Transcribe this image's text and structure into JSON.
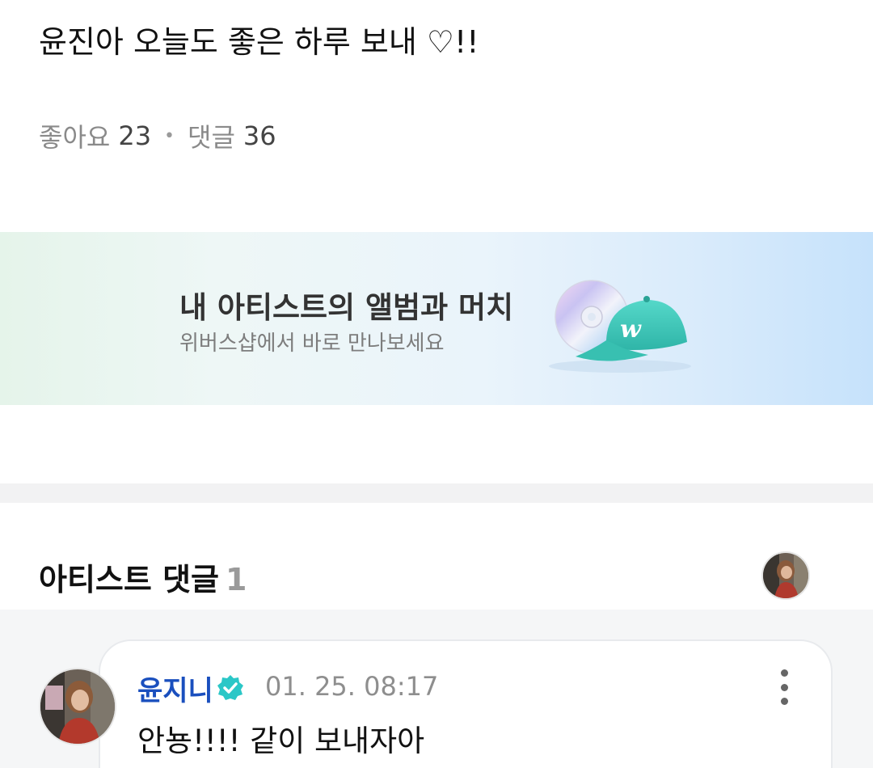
{
  "post": {
    "text": "윤진아 오늘도 좋은 하루 보내 ♡!!",
    "likes_label": "좋아요",
    "likes_count": "23",
    "comments_label": "댓글",
    "comments_count": "36"
  },
  "banner": {
    "title": "내 아티스트의 앨범과 머치",
    "subtitle": "위버스샵에서 바로 만나보세요",
    "icon": "album-and-cap-icon"
  },
  "artist_comments": {
    "title": "아티스트 댓글",
    "count": "1",
    "items": [
      {
        "author": "윤지니",
        "verified": true,
        "time": "01. 25. 08:17",
        "text": "안뇽!!!! 같이 보내자아"
      }
    ]
  },
  "colors": {
    "author_name": "#1a4fbe",
    "verified_badge": "#2bc7c7",
    "cap": "#3cc9bb"
  }
}
